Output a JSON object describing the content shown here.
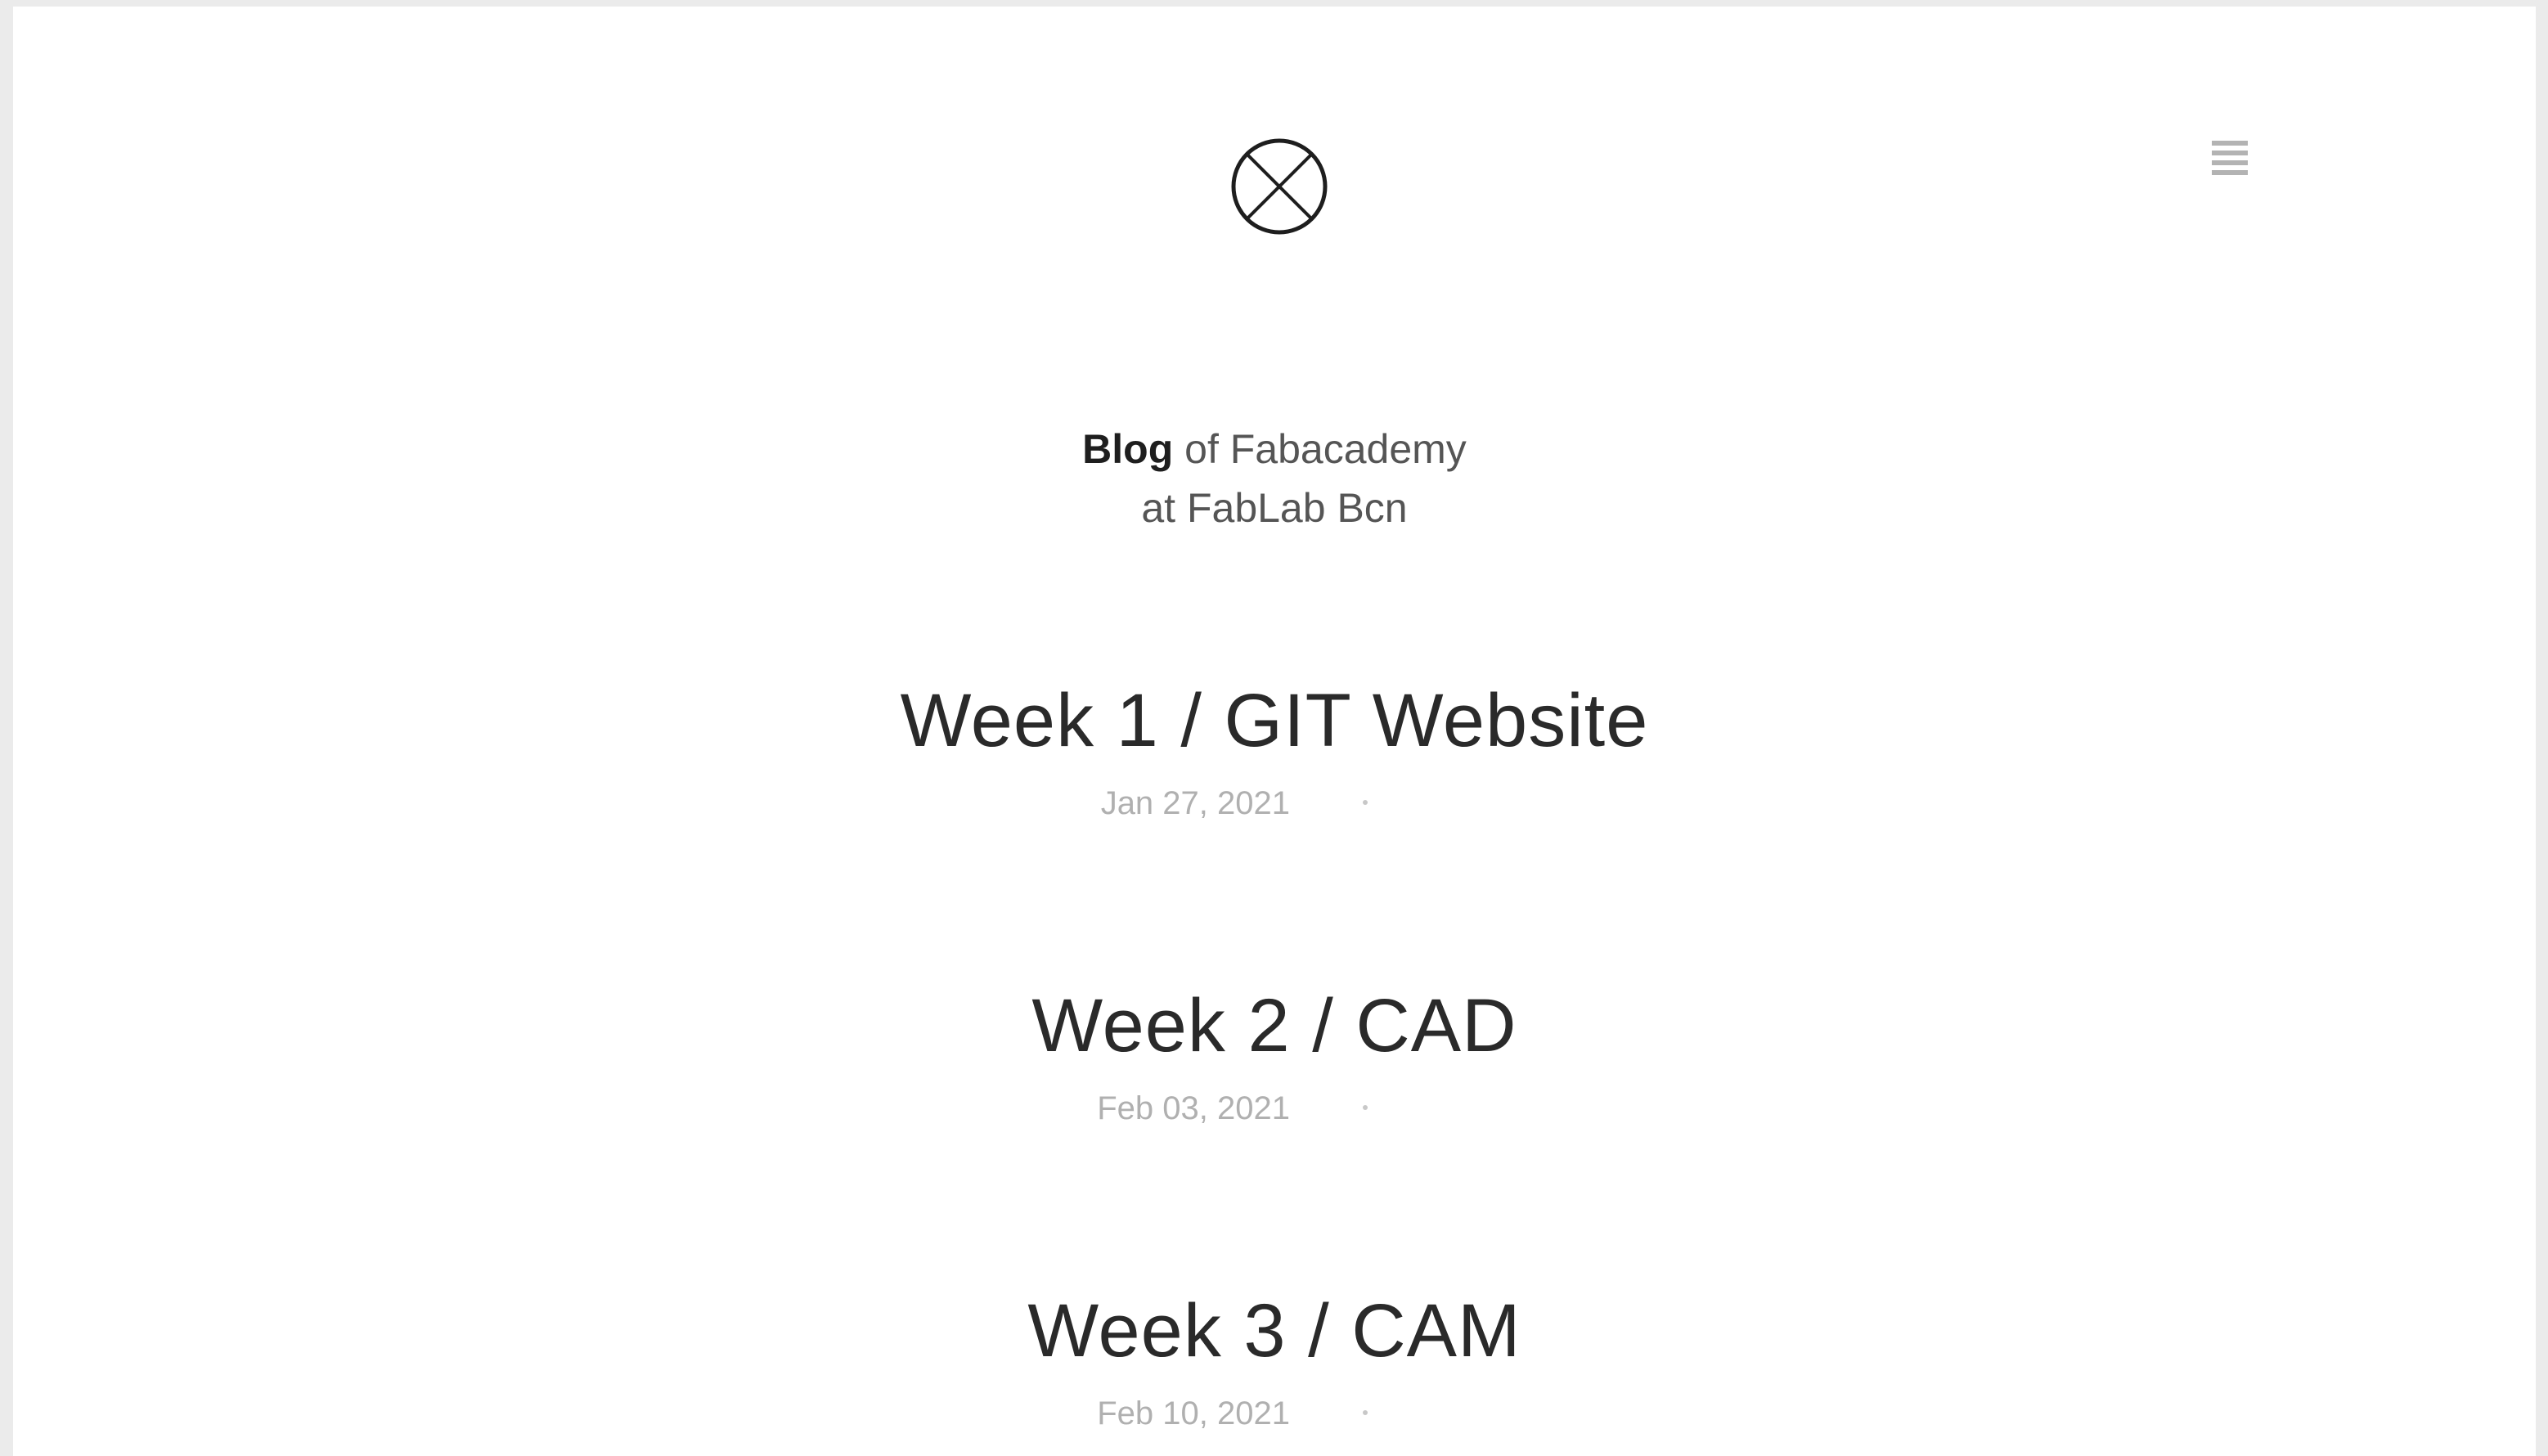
{
  "header": {
    "logo_icon": "circled-x-icon",
    "menu_icon": "hamburger-menu-icon"
  },
  "site_title": {
    "strong": "Blog",
    "rest": "of Fabacademy",
    "line2": "at FabLab Bcn"
  },
  "posts": [
    {
      "title": "Week 1 / GIT Website",
      "date": "Jan 27, 2021"
    },
    {
      "title": "Week 2 / CAD",
      "date": "Feb 03, 2021"
    },
    {
      "title": "Week 3 / CAM",
      "date": "Feb 10, 2021"
    }
  ],
  "colors": {
    "page_background": "#ffffff",
    "outer_background": "#ebebeb",
    "text_dark": "#1e1e1e",
    "text_muted": "#b0b0b0"
  }
}
